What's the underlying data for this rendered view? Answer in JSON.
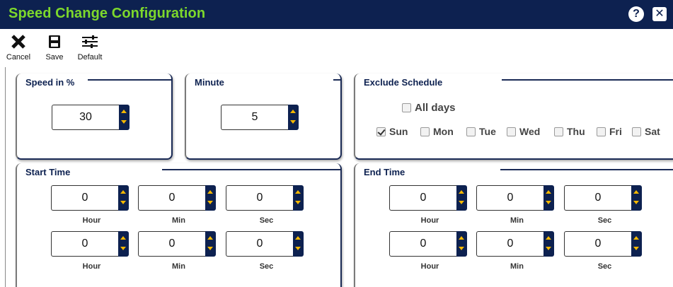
{
  "window": {
    "title": "Speed Change Configuration",
    "help_icon": "question-icon",
    "close_icon": "close-icon"
  },
  "toolbar": {
    "cancel_label": "Cancel",
    "save_label": "Save",
    "default_label": "Default"
  },
  "speed": {
    "title": "Speed in %",
    "value": "30"
  },
  "minute": {
    "title": "Minute",
    "value": "5"
  },
  "exclude": {
    "title": "Exclude Schedule",
    "all_days": {
      "label": "All days",
      "checked": false
    },
    "days": [
      {
        "label": "Sun",
        "checked": true
      },
      {
        "label": "Mon",
        "checked": false
      },
      {
        "label": "Tue",
        "checked": false
      },
      {
        "label": "Wed",
        "checked": false
      },
      {
        "label": "Thu",
        "checked": false
      },
      {
        "label": "Fri",
        "checked": false
      },
      {
        "label": "Sat",
        "checked": false
      }
    ]
  },
  "start_time": {
    "title": "Start Time",
    "rows": [
      {
        "hour": "0",
        "min": "0",
        "sec": "0"
      },
      {
        "hour": "0",
        "min": "0",
        "sec": "0"
      }
    ]
  },
  "end_time": {
    "title": "End Time",
    "rows": [
      {
        "hour": "0",
        "min": "0",
        "sec": "0"
      },
      {
        "hour": "0",
        "min": "0",
        "sec": "0"
      }
    ]
  },
  "units": {
    "hour": "Hour",
    "min": "Min",
    "sec": "Sec"
  },
  "colors": {
    "titlebar_bg": "#0d2150",
    "title_text": "#7dd82c",
    "spinner_bg": "#0d2150",
    "spinner_arrow": "#f5b800"
  }
}
